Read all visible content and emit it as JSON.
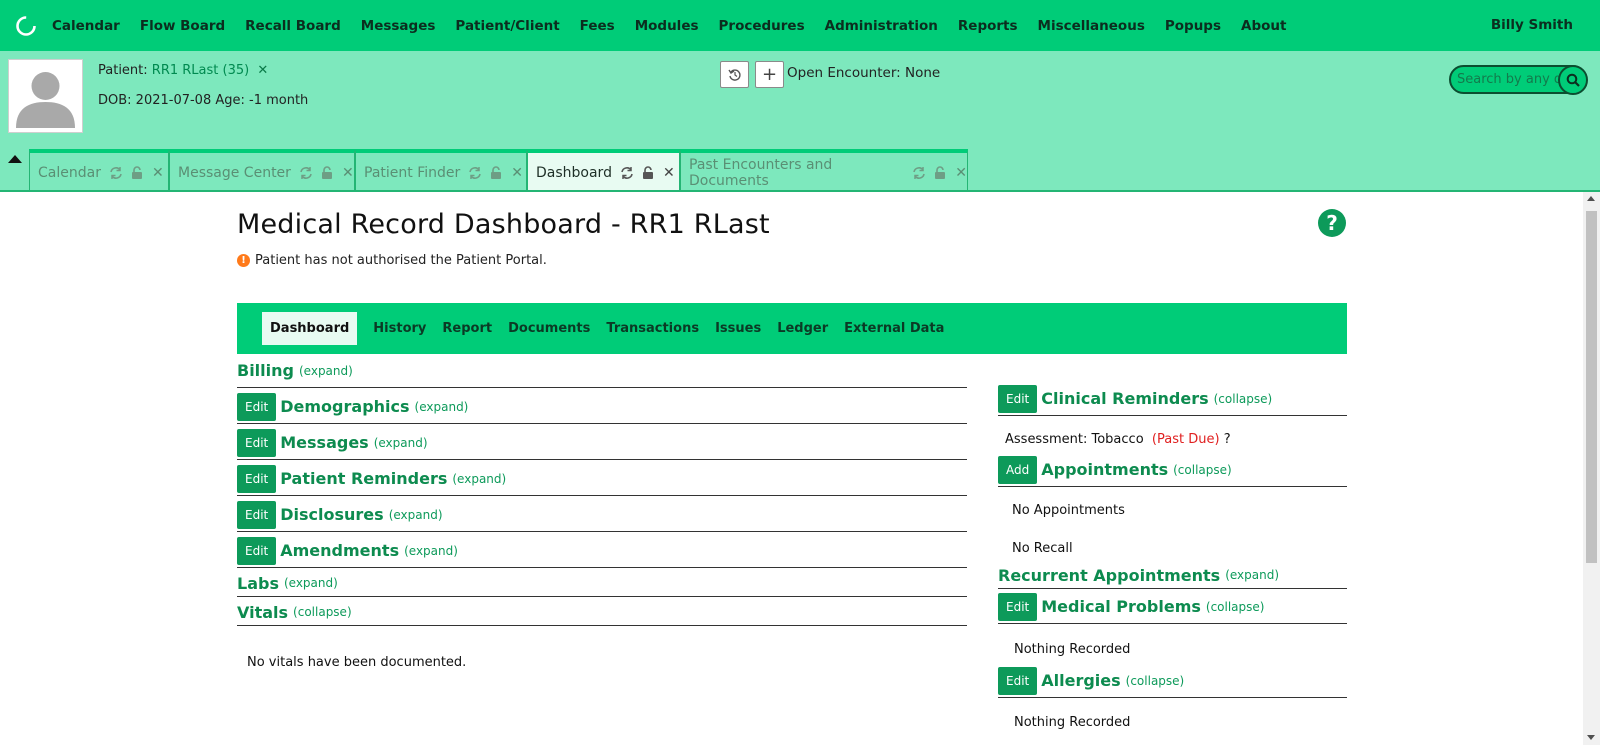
{
  "nav": {
    "items": [
      "Calendar",
      "Flow Board",
      "Recall Board",
      "Messages",
      "Patient/Client",
      "Fees",
      "Modules",
      "Procedures",
      "Administration",
      "Reports",
      "Miscellaneous",
      "Popups",
      "About"
    ],
    "user": "Billy Smith"
  },
  "patient": {
    "label": "Patient:",
    "name": "RR1 RLast (35)",
    "dob_line": "DOB: 2021-07-08 Age: -1 month"
  },
  "encounter": {
    "text": "Open Encounter: None"
  },
  "search": {
    "placeholder": "Search by any demographics"
  },
  "tabs": [
    {
      "label": "Calendar",
      "active": false
    },
    {
      "label": "Message Center",
      "active": false
    },
    {
      "label": "Patient Finder",
      "active": false
    },
    {
      "label": "Dashboard",
      "active": true
    },
    {
      "label": "Past Encounters and Documents",
      "active": false
    }
  ],
  "page": {
    "title": "Medical Record Dashboard - RR1 RLast",
    "warning": "Patient has not authorised the Patient Portal."
  },
  "subnav": [
    "Dashboard",
    "History",
    "Report",
    "Documents",
    "Transactions",
    "Issues",
    "Ledger",
    "External Data"
  ],
  "left_sections": [
    {
      "title": "Billing",
      "toggle": "(expand)",
      "edit": ""
    },
    {
      "title": "Demographics",
      "toggle": "(expand)",
      "edit": "Edit"
    },
    {
      "title": "Messages",
      "toggle": "(expand)",
      "edit": "Edit"
    },
    {
      "title": "Patient Reminders",
      "toggle": "(expand)",
      "edit": "Edit"
    },
    {
      "title": "Disclosures",
      "toggle": "(expand)",
      "edit": "Edit"
    },
    {
      "title": "Amendments",
      "toggle": "(expand)",
      "edit": "Edit"
    },
    {
      "title": "Labs",
      "toggle": "(expand)",
      "edit": ""
    },
    {
      "title": "Vitals",
      "toggle": "(collapse)",
      "edit": ""
    }
  ],
  "vitals_text": "No vitals have been documented.",
  "right": {
    "clinical": {
      "title": "Clinical Reminders",
      "toggle": "(collapse)",
      "edit": "Edit"
    },
    "reminder": {
      "name": "Assessment: Tobacco",
      "status": "(Past Due)",
      "q": "?"
    },
    "appointments": {
      "title": "Appointments",
      "toggle": "(collapse)",
      "edit": "Add"
    },
    "no_appointments": "No Appointments",
    "no_recall": "No Recall",
    "recurrent": {
      "title": "Recurrent Appointments",
      "toggle": "(expand)"
    },
    "medical": {
      "title": "Medical Problems",
      "toggle": "(collapse)",
      "edit": "Edit"
    },
    "medical_text": "Nothing Recorded",
    "allergies": {
      "title": "Allergies",
      "toggle": "(collapse)",
      "edit": "Edit"
    },
    "allergies_text": "Nothing Recorded"
  },
  "colors": {
    "primary": "#00cc78",
    "header_bg": "#7de8bd",
    "accent_dark": "#0d9a5a",
    "past_due": "#e02020"
  }
}
